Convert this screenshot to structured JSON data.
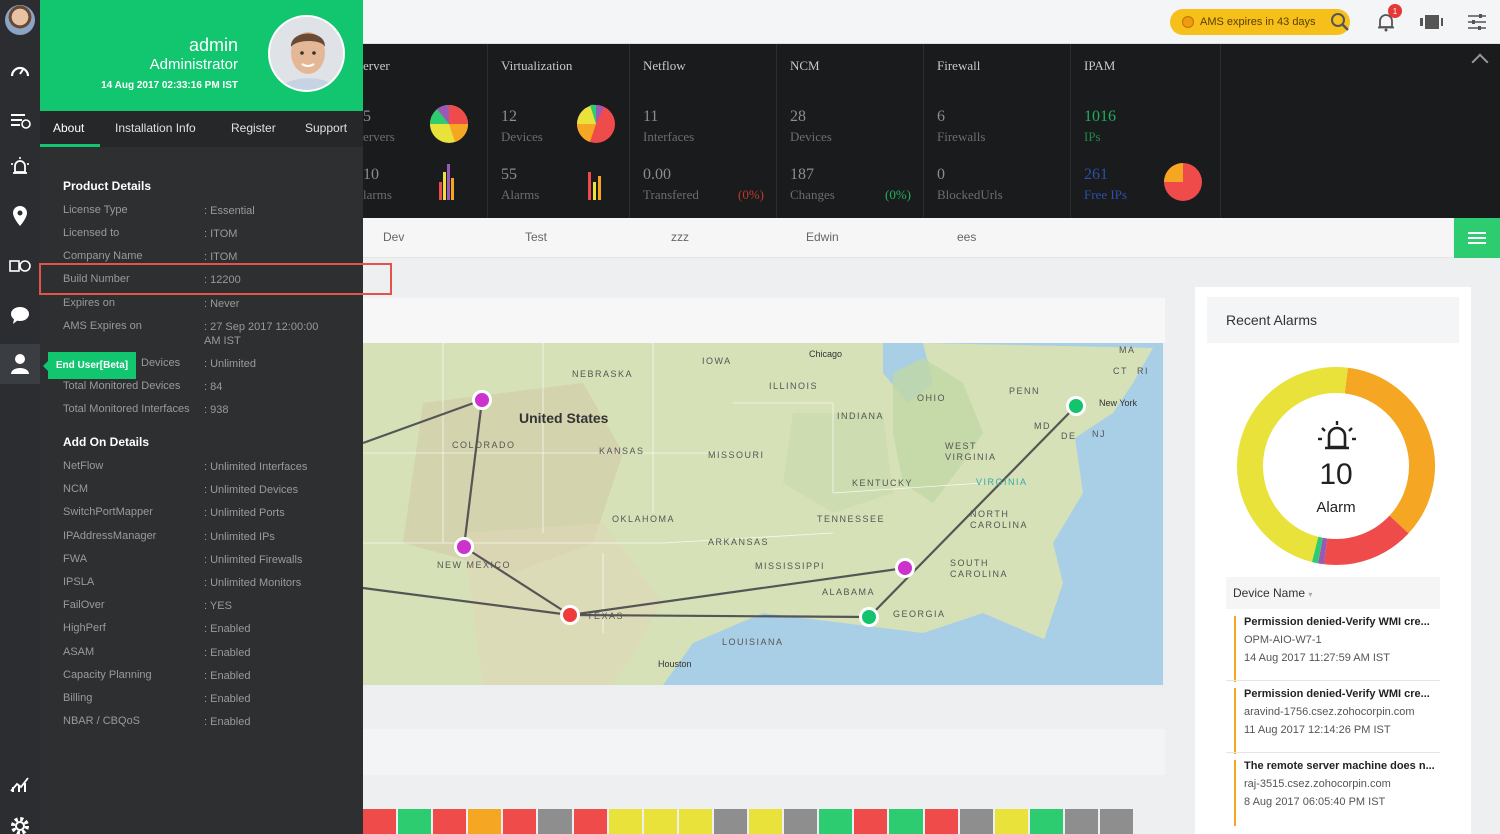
{
  "topbar": {
    "ams_badge": "AMS expires in 43 days",
    "notification_count": "1"
  },
  "stats": [
    {
      "title": "Server",
      "title_visible": "erver",
      "n1": "5",
      "l1": "ervers",
      "n2": "10",
      "l2": "larms"
    },
    {
      "title": "Virtualization",
      "n1": "12",
      "l1": "Devices",
      "n2": "55",
      "l2": "Alarms"
    },
    {
      "title": "Netflow",
      "n1": "11",
      "l1": "Interfaces",
      "n2": "0.00",
      "l2": "Transfered",
      "pct": "(0%)"
    },
    {
      "title": "NCM",
      "n1": "28",
      "l1": "Devices",
      "n2": "187",
      "l2": "Changes",
      "pct": "(0%)"
    },
    {
      "title": "Firewall",
      "n1": "6",
      "l1": "Firewalls",
      "n2": "0",
      "l2": "BlockedUrls"
    },
    {
      "title": "IPAM",
      "n1": "1016",
      "l1": "IPs",
      "n2": "261",
      "l2": "Free IPs"
    }
  ],
  "tabs": [
    "Dev",
    "Test",
    "zzz",
    "Edwin",
    "ees"
  ],
  "map": {
    "country": "United States",
    "states": [
      "NEBRASKA",
      "IOWA",
      "ILLINOIS",
      "INDIANA",
      "OHIO",
      "PENN",
      "KANSAS",
      "MISSOURI",
      "KENTUCKY",
      "WEST VIRGINIA",
      "VIRGINIA",
      "OKLAHOMA",
      "TENNESSEE",
      "NORTH CAROLINA",
      "ARKANSAS",
      "SOUTH CAROLINA",
      "MISSISSIPPI",
      "ALABAMA",
      "GEORGIA",
      "LOUISIANA",
      "TEXAS",
      "NEW MEXICO",
      "COLORADO",
      "MD",
      "DE",
      "NJ",
      "CT",
      "RI",
      "MA"
    ],
    "cities": [
      "Chicago",
      "New York",
      "Houston"
    ]
  },
  "recent_alarms": {
    "title": "Recent Alarms",
    "count": "10",
    "count_label": "Alarm",
    "device_header": "Device Name",
    "items": [
      {
        "title": "Permission denied-Verify WMI cre...",
        "device": "OPM-AIO-W7-1",
        "time": "14 Aug 2017 11:27:59 AM IST"
      },
      {
        "title": "Permission denied-Verify WMI cre...",
        "device": "aravind-1756.csez.zohocorpin.com",
        "time": "11 Aug 2017 12:14:26 PM IST"
      },
      {
        "title": "The remote server machine does n...",
        "device": "raj-3515.csez.zohocorpin.com",
        "time": "8 Aug 2017 06:05:40 PM IST"
      }
    ],
    "donut_segments": [
      {
        "color": "#f5a623",
        "value": 0.35
      },
      {
        "color": "#ef4b4b",
        "value": 0.15
      },
      {
        "color": "#9b59b6",
        "value": 0.01
      },
      {
        "color": "#2ecc71",
        "value": 0.01
      },
      {
        "color": "#e8e23a",
        "value": 0.48
      }
    ]
  },
  "panel": {
    "user_name": "admin",
    "role": "Administrator",
    "timestamp": "14 Aug 2017 02:33:16 PM IST",
    "tabs": [
      "About",
      "Installation Info",
      "Register",
      "Support"
    ],
    "product_title": "Product Details",
    "product": [
      {
        "k": "License Type",
        "v": ": Essential"
      },
      {
        "k": "Licensed to",
        "v": ": ITOM"
      },
      {
        "k": "Company Name",
        "v": ": ITOM"
      },
      {
        "k": "Build Number",
        "v": ": 12200"
      },
      {
        "k": "Expires on",
        "v": ": Never"
      },
      {
        "k": "AMS Expires on",
        "v": ": 27 Sep 2017 12:00:00 AM IST"
      },
      {
        "k": "Devices",
        "v": ": Unlimited"
      },
      {
        "k": "Total Monitored Devices",
        "v": ": 84"
      },
      {
        "k": "Total Monitored Interfaces",
        "v": ": 938"
      }
    ],
    "addon_title": "Add On Details",
    "addons": [
      {
        "k": "NetFlow",
        "v": ": Unlimited Interfaces"
      },
      {
        "k": "NCM",
        "v": ": Unlimited Devices"
      },
      {
        "k": "SwitchPortMapper",
        "v": ": Unlimited Ports"
      },
      {
        "k": "IPAddressManager",
        "v": ": Unlimited IPs"
      },
      {
        "k": "FWA",
        "v": ": Unlimited Firewalls"
      },
      {
        "k": "IPSLA",
        "v": ": Unlimited Monitors"
      },
      {
        "k": "FailOver",
        "v": ": YES"
      },
      {
        "k": "HighPerf",
        "v": ": Enabled"
      },
      {
        "k": "ASAM",
        "v": ": Enabled"
      },
      {
        "k": "Capacity Planning",
        "v": ": Enabled"
      },
      {
        "k": "Billing",
        "v": ": Enabled"
      },
      {
        "k": "NBAR / CBQoS",
        "v": ": Enabled"
      }
    ],
    "enduser_badge": "End User[Beta]"
  },
  "heat_colors": [
    "#ef4b4b",
    "#2ecc71",
    "#ef4b4b",
    "#f5a623",
    "#ef4b4b",
    "#8e8e8e",
    "#ef4b4b",
    "#e8e23a",
    "#e8e23a",
    "#e8e23a",
    "#8e8e8e",
    "#e8e23a",
    "#8e8e8e",
    "#2ecc71",
    "#ef4b4b",
    "#2ecc71",
    "#ef4b4b",
    "#8e8e8e",
    "#e8e23a",
    "#2ecc71",
    "#8e8e8e",
    "#8e8e8e"
  ]
}
